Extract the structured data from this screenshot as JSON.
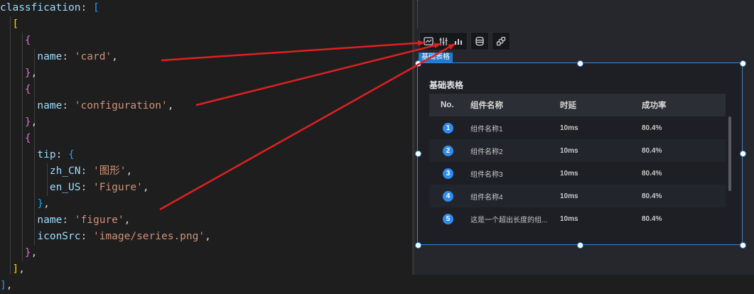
{
  "editor": {
    "lines": [
      {
        "indent": "",
        "parts": [
          [
            "key",
            "classfication"
          ],
          [
            "pun",
            ": "
          ],
          [
            "br3",
            "["
          ]
        ]
      },
      {
        "indent": "  ",
        "parts": [
          [
            "br1",
            "["
          ]
        ]
      },
      {
        "indent": "    ",
        "parts": [
          [
            "br2",
            "{"
          ]
        ]
      },
      {
        "indent": "      ",
        "parts": [
          [
            "prop",
            "name"
          ],
          [
            "pun",
            ": "
          ],
          [
            "str",
            "'card'"
          ],
          [
            "pun",
            ","
          ]
        ]
      },
      {
        "indent": "    ",
        "parts": [
          [
            "br2",
            "}"
          ],
          [
            "pun",
            ","
          ]
        ]
      },
      {
        "indent": "    ",
        "parts": [
          [
            "br2",
            "{"
          ]
        ]
      },
      {
        "indent": "      ",
        "parts": [
          [
            "prop",
            "name"
          ],
          [
            "pun",
            ": "
          ],
          [
            "str",
            "'configuration'"
          ],
          [
            "pun",
            ","
          ]
        ]
      },
      {
        "indent": "    ",
        "parts": [
          [
            "br2",
            "}"
          ],
          [
            "pun",
            ","
          ]
        ]
      },
      {
        "indent": "    ",
        "parts": [
          [
            "br2",
            "{"
          ]
        ]
      },
      {
        "indent": "      ",
        "parts": [
          [
            "prop",
            "tip"
          ],
          [
            "pun",
            ": "
          ],
          [
            "br3",
            "{"
          ]
        ]
      },
      {
        "indent": "        ",
        "parts": [
          [
            "prop",
            "zh_CN"
          ],
          [
            "pun",
            ": "
          ],
          [
            "str",
            "'图形'"
          ],
          [
            "pun",
            ","
          ]
        ]
      },
      {
        "indent": "        ",
        "parts": [
          [
            "prop",
            "en_US"
          ],
          [
            "pun",
            ": "
          ],
          [
            "str",
            "'Figure'"
          ],
          [
            "pun",
            ","
          ]
        ]
      },
      {
        "indent": "      ",
        "parts": [
          [
            "br3",
            "}"
          ],
          [
            "pun",
            ","
          ]
        ]
      },
      {
        "indent": "      ",
        "parts": [
          [
            "prop",
            "name"
          ],
          [
            "pun",
            ": "
          ],
          [
            "str",
            "'figure'"
          ],
          [
            "pun",
            ","
          ]
        ]
      },
      {
        "indent": "      ",
        "parts": [
          [
            "prop",
            "iconSrc"
          ],
          [
            "pun",
            ": "
          ],
          [
            "str",
            "'image/series.png'"
          ],
          [
            "pun",
            ","
          ]
        ]
      },
      {
        "indent": "    ",
        "parts": [
          [
            "br2",
            "}"
          ],
          [
            "pun",
            ","
          ]
        ]
      },
      {
        "indent": "  ",
        "parts": [
          [
            "br1",
            "]"
          ],
          [
            "pun",
            ","
          ]
        ]
      },
      {
        "indent": "",
        "parts": [
          [
            "br3",
            "]"
          ],
          [
            "pun",
            ","
          ]
        ]
      }
    ]
  },
  "toolbar": {
    "groups": [
      {
        "icons": [
          "card-icon",
          "configuration-icon",
          "figure-icon"
        ]
      },
      {
        "icons": [
          "database-icon"
        ]
      },
      {
        "icons": [
          "link-icon"
        ]
      }
    ]
  },
  "widget": {
    "tag": "基础表格",
    "title": "基础表格",
    "columns": [
      "No.",
      "组件名称",
      "时延",
      "成功率"
    ],
    "rows": [
      {
        "no": "1",
        "name": "组件名称1",
        "delay": "10ms",
        "rate": "80.4%"
      },
      {
        "no": "2",
        "name": "组件名称2",
        "delay": "10ms",
        "rate": "80.4%"
      },
      {
        "no": "3",
        "name": "组件名称3",
        "delay": "10ms",
        "rate": "80.4%"
      },
      {
        "no": "4",
        "name": "组件名称4",
        "delay": "10ms",
        "rate": "80.4%"
      },
      {
        "no": "5",
        "name": "这是一个超出长度的组...",
        "delay": "10ms",
        "rate": "80.4%"
      }
    ]
  },
  "colors": {
    "accent": "#2f8cf0",
    "arrow": "#e02020",
    "selection": "#3b83d6"
  }
}
